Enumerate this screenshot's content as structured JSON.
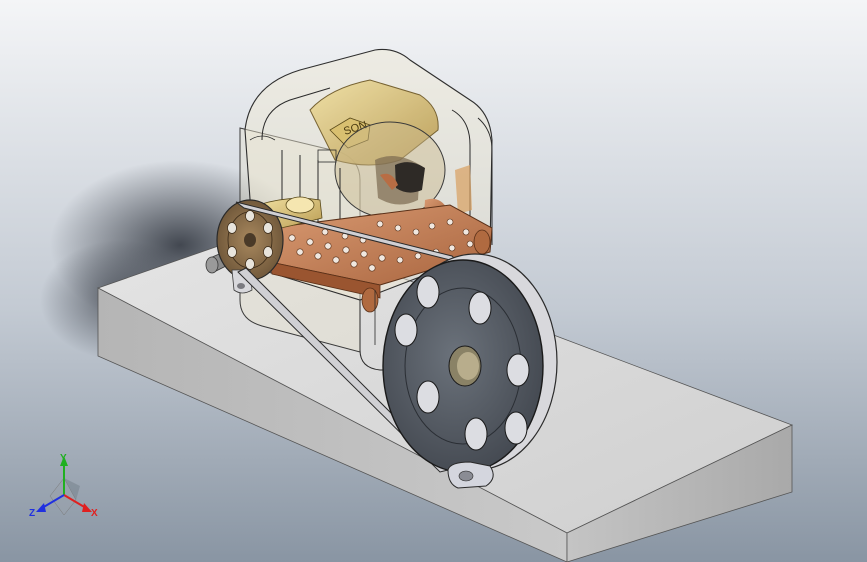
{
  "viewport": {
    "background_top": "#f2f4f6",
    "background_bottom": "#8a97a5"
  },
  "model": {
    "description_icon": "motor-pulley-assembly-3d-model",
    "base_color": "#d6d6d6",
    "housing_color": "#ece1b8",
    "copper_color": "#c8835a",
    "pulley_color": "#5a6068"
  },
  "triad": {
    "axis_x": "X",
    "axis_y": "Y",
    "axis_z": "Z",
    "color_x": "#e02020",
    "color_y": "#20b020",
    "color_z": "#2030e0"
  }
}
